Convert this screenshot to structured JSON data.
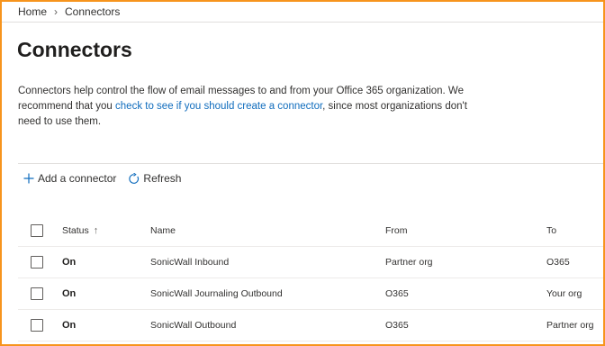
{
  "breadcrumb": {
    "home": "Home",
    "current": "Connectors"
  },
  "page": {
    "title": "Connectors"
  },
  "description": {
    "part1": "Connectors help control the flow of email messages to and from your Office 365 organization. We recommend that you ",
    "link": "check to see if you should create a connector",
    "part2": ", since most organizations don't need to use them."
  },
  "toolbar": {
    "add_label": "Add a connector",
    "refresh_label": "Refresh"
  },
  "table": {
    "columns": {
      "status": "Status",
      "name": "Name",
      "from": "From",
      "to": "To"
    },
    "rows": [
      {
        "status": "On",
        "name": "SonicWall Inbound",
        "from": "Partner org",
        "to": "O365"
      },
      {
        "status": "On",
        "name": "SonicWall Journaling Outbound",
        "from": "O365",
        "to": "Your org"
      },
      {
        "status": "On",
        "name": "SonicWall Outbound",
        "from": "O365",
        "to": "Partner org"
      }
    ]
  },
  "icons": {
    "breadcrumb_separator": "chevron-right-icon",
    "add": "plus-icon",
    "refresh": "refresh-icon",
    "sort": "arrow-up-icon"
  },
  "colors": {
    "accent": "#0f6cbd",
    "frame_border": "#f7941d"
  }
}
